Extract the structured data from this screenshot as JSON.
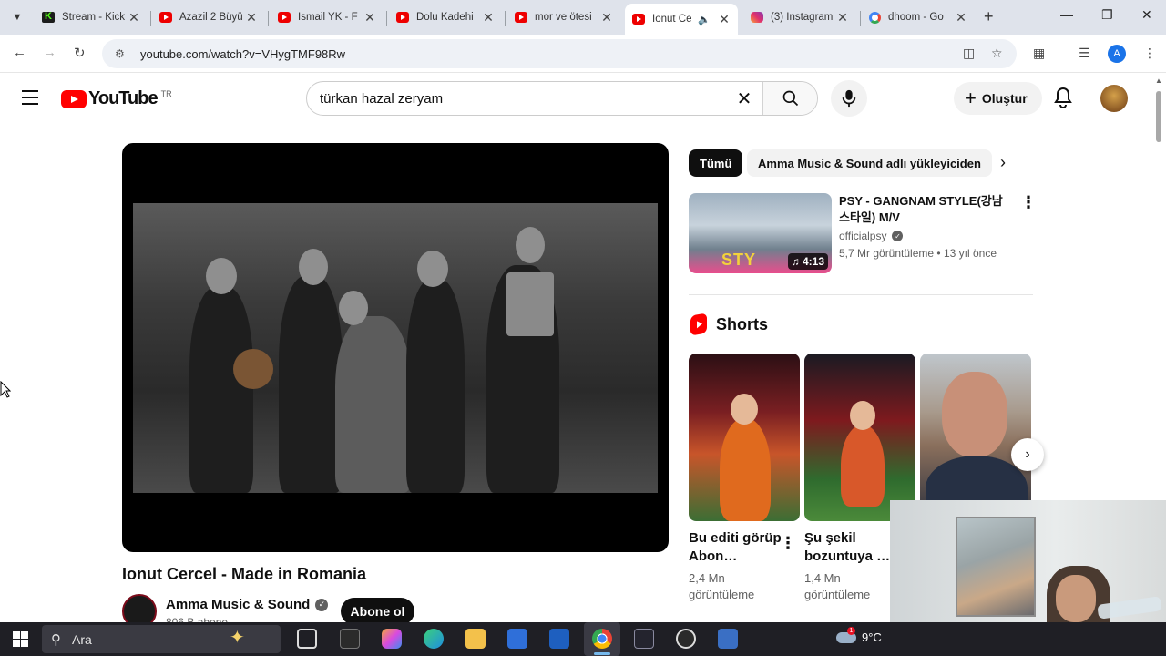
{
  "browser": {
    "tabs": [
      {
        "title": "Stream - Kick",
        "icon": "kick-icon"
      },
      {
        "title": "Azazil 2 Büyü",
        "icon": "youtube-icon"
      },
      {
        "title": "İsmail YK - F",
        "icon": "youtube-icon"
      },
      {
        "title": "Dolu Kadehi",
        "icon": "youtube-icon"
      },
      {
        "title": "mor ve ötesi",
        "icon": "youtube-icon"
      },
      {
        "title": "Ionut Ce",
        "icon": "youtube-icon",
        "active": true,
        "audio": true
      },
      {
        "title": "(3) Instagram",
        "icon": "instagram-icon"
      },
      {
        "title": "dhoom - Go",
        "icon": "google-icon"
      }
    ],
    "url": "youtube.com/watch?v=VHygTMF98Rw",
    "profile_initial": "A"
  },
  "youtube": {
    "logo_text": "YouTube",
    "country_code": "TR",
    "search_query": "türkan hazal zeryam",
    "create_label": "Oluştur",
    "video": {
      "title": "Ionut Cercel - Made in Romania",
      "channel": "Amma Music & Sound",
      "subscribers": "806 B abone",
      "subscribe_label": "Abone ol"
    },
    "chips": [
      "Tümü",
      "Amma Music & Sound adlı yükleyiciden"
    ],
    "recommended": [
      {
        "title": "PSY - GANGNAM STYLE(강남스타일) M/V",
        "channel": "officialpsy",
        "views": "5,7 Mr görüntüleme",
        "age": "13 yıl önce",
        "duration": "4:13",
        "thumb_text": "STY"
      }
    ],
    "shorts_label": "Shorts",
    "shorts": [
      {
        "title": "Bu editi görüp Abon…",
        "views": "2,4 Mn görüntüleme"
      },
      {
        "title": "Şu şekil bozuntuya …",
        "views": "1,4 Mn görüntüleme"
      },
      {
        "title": "",
        "views": ""
      }
    ]
  },
  "taskbar": {
    "search_placeholder": "Ara",
    "temperature": "9°C",
    "notification_count": "1"
  },
  "colors": {
    "youtube_red": "#ff0000",
    "taskbar_bg": "#1f1f25",
    "tabstrip_bg": "#dfe3eb"
  }
}
